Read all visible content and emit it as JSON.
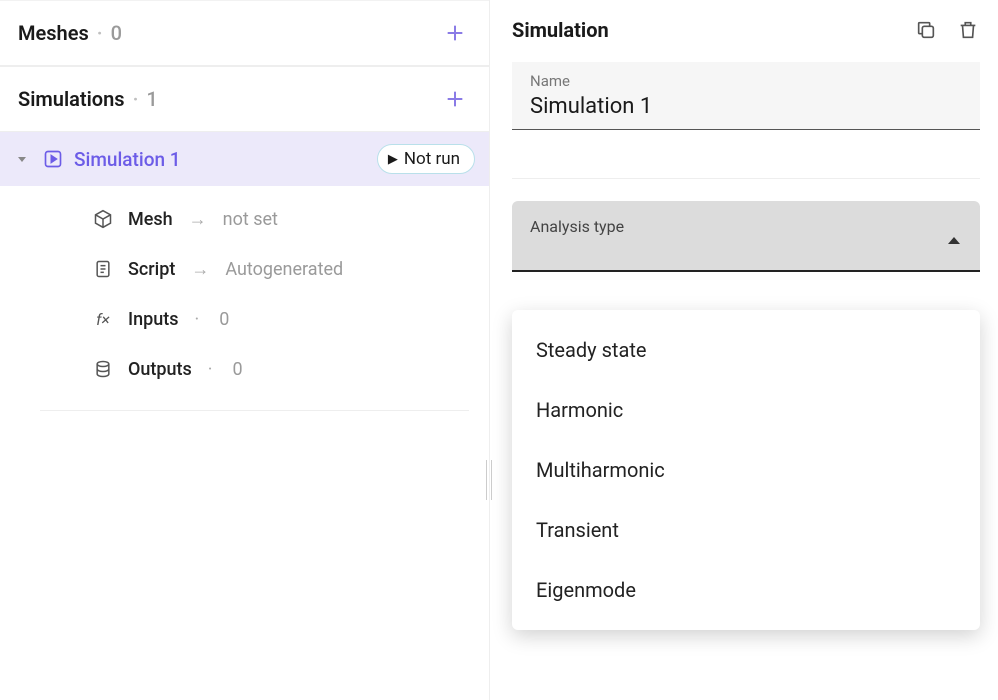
{
  "sidebar": {
    "sections": [
      {
        "title": "Meshes",
        "count": "0"
      },
      {
        "title": "Simulations",
        "count": "1"
      }
    ],
    "simulation": {
      "name": "Simulation 1",
      "status": "Not run"
    },
    "tree": {
      "mesh": {
        "label": "Mesh",
        "value": "not set"
      },
      "script": {
        "label": "Script",
        "value": "Autogenerated"
      },
      "inputs": {
        "label": "Inputs",
        "count": "0"
      },
      "outputs": {
        "label": "Outputs",
        "count": "0"
      }
    },
    "glyphs": {
      "arrow": "→",
      "dot": "·"
    }
  },
  "detail": {
    "header": "Simulation",
    "name_label": "Name",
    "name_value": "Simulation 1",
    "analysis_label": "Analysis type",
    "dropdown_options": [
      "Steady state",
      "Harmonic",
      "Multiharmonic",
      "Transient",
      "Eigenmode"
    ]
  }
}
